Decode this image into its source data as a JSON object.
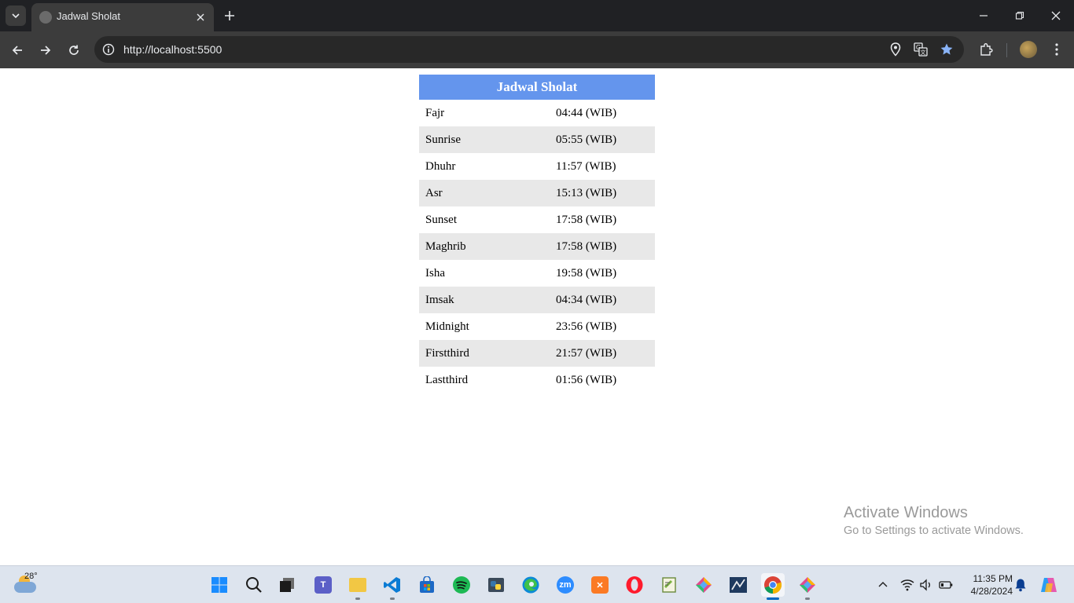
{
  "browser": {
    "tab_title": "Jadwal Sholat",
    "url": "http://localhost:5500"
  },
  "schedule": {
    "title": "Jadwal Sholat",
    "rows": [
      {
        "name": "Fajr",
        "time": "04:44 (WIB)"
      },
      {
        "name": "Sunrise",
        "time": "05:55 (WIB)"
      },
      {
        "name": "Dhuhr",
        "time": "11:57 (WIB)"
      },
      {
        "name": "Asr",
        "time": "15:13 (WIB)"
      },
      {
        "name": "Sunset",
        "time": "17:58 (WIB)"
      },
      {
        "name": "Maghrib",
        "time": "17:58 (WIB)"
      },
      {
        "name": "Isha",
        "time": "19:58 (WIB)"
      },
      {
        "name": "Imsak",
        "time": "04:34 (WIB)"
      },
      {
        "name": "Midnight",
        "time": "23:56 (WIB)"
      },
      {
        "name": "Firstthird",
        "time": "21:57 (WIB)"
      },
      {
        "name": "Lastthird",
        "time": "01:56 (WIB)"
      }
    ]
  },
  "watermark": {
    "title": "Activate Windows",
    "subtitle": "Go to Settings to activate Windows."
  },
  "taskbar": {
    "weather_temp": "28°",
    "time": "11:35 PM",
    "date": "4/28/2024",
    "apps": [
      "windows-start",
      "search",
      "task-view",
      "teams",
      "file-explorer",
      "vscode",
      "microsoft-store",
      "spotify",
      "python-idle",
      "edge",
      "zoom",
      "xampp",
      "opera",
      "notepad-plus",
      "git-app",
      "terminal-app",
      "chrome",
      "git-app-2"
    ]
  },
  "colors": {
    "header_bg": "#6495ed",
    "alt_row_bg": "#e8e8e8",
    "accent": "#0067c0"
  }
}
